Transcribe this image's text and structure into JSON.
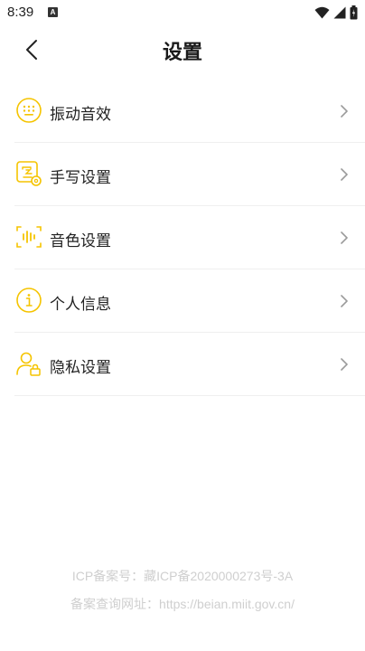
{
  "status_bar": {
    "time": "8:39",
    "notification_glyph": "A",
    "icons": [
      "wifi-icon",
      "signal-icon",
      "battery-icon"
    ]
  },
  "header": {
    "title": "设置",
    "back_icon": "chevron-left-icon"
  },
  "menu": {
    "items": [
      {
        "label": "振动音效",
        "icon": "vibration-keyboard-icon"
      },
      {
        "label": "手写设置",
        "icon": "handwriting-settings-icon"
      },
      {
        "label": "音色设置",
        "icon": "voice-timbre-icon"
      },
      {
        "label": "个人信息",
        "icon": "info-icon"
      },
      {
        "label": "隐私设置",
        "icon": "privacy-user-lock-icon"
      }
    ]
  },
  "footer": {
    "icp": "ICP备案号：藏ICP备2020000273号-3A",
    "query": "备案查询网址：https://beian.miit.gov.cn/"
  },
  "colors": {
    "accent": "#f5c400",
    "text": "#222222",
    "divider": "#efefef",
    "footer_text": "#cfcfcf",
    "chevron": "#9a9a9a"
  }
}
